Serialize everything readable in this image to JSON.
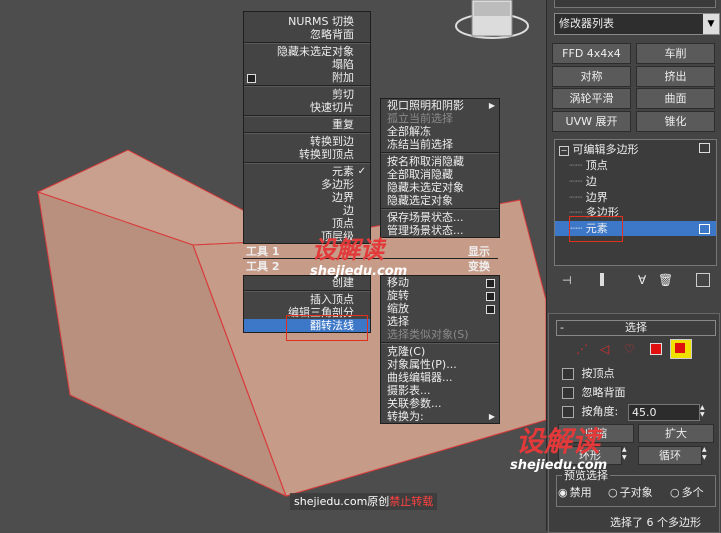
{
  "quad1": {
    "items": [
      "NURMS 切换",
      "忽略背面",
      "隐藏未选定对象",
      "塌陷",
      "附加",
      "剪切",
      "快速切片",
      "重复",
      "转换到边",
      "转换到顶点",
      "元素",
      "多边形",
      "边界",
      "边",
      "顶点",
      "顶层级"
    ],
    "label": "工具 1"
  },
  "quad2_label": "工具 2",
  "quad3": {
    "items": [
      "创建",
      "插入顶点",
      "编辑三角剖分",
      "翻转法线"
    ],
    "selected": "翻转法线"
  },
  "quad_right_top": {
    "items": [
      "视口照明和阴影",
      "孤立当前选择",
      "全部解冻",
      "冻结当前选择",
      "按名称取消隐藏",
      "全部取消隐藏",
      "隐藏未选定对象",
      "隐藏选定对象",
      "保存场景状态...",
      "管理场景状态..."
    ],
    "label": "显示"
  },
  "quad_right_bottom": {
    "label": "变换",
    "items": [
      "移动",
      "旋转",
      "缩放",
      "选择",
      "选择类似对象(S)",
      "克隆(C)",
      "对象属性(P)...",
      "曲线编辑器...",
      "摄影表...",
      "关联参数...",
      "转换为:"
    ]
  },
  "right_panel": {
    "modifier_list": "修改器列表",
    "buttons": [
      "FFD 4x4x4",
      "车削",
      "对称",
      "挤出",
      "涡轮平滑",
      "曲面",
      "UVW 展开",
      "锥化"
    ],
    "stack_root": "可编辑多边形",
    "stack_children": [
      "顶点",
      "边",
      "边界",
      "多边形",
      "元素"
    ],
    "stack_selected": "元素",
    "rollout_title": "选择",
    "checkboxes": [
      "按顶点",
      "忽略背面",
      "按角度:"
    ],
    "angle_value": "45.0",
    "shrink": "收缩",
    "grow": "扩大",
    "ring": "环形",
    "loop": "循环",
    "preview_label": "预览选择",
    "radios": [
      "禁用",
      "子对象",
      "多个"
    ],
    "status": "选择了 6 个多边形"
  },
  "watermark": {
    "logo": "设解读",
    "url": "shejiedu.com",
    "caption": "shejiedu.com原创",
    "caption_red": "禁止转载"
  },
  "colors": {
    "accent": "#3d78c8",
    "face": "#caa08e",
    "edge": "#d83b3b",
    "highlight": "#e0301e"
  }
}
